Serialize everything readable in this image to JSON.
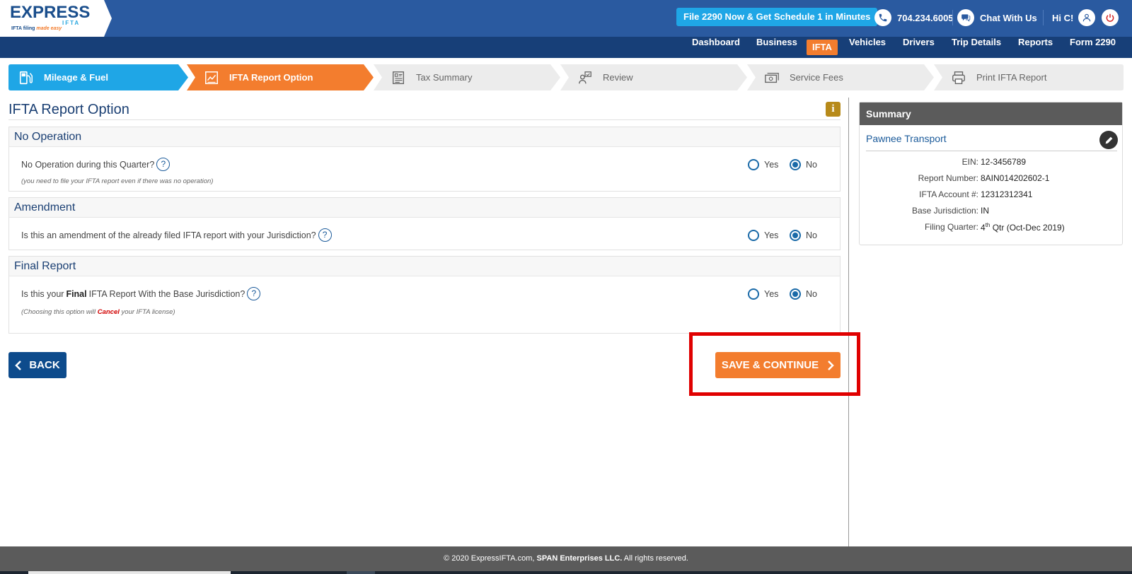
{
  "header": {
    "logo_text_e": "E",
    "logo_text_rest": "XPRESS",
    "logo_sub": "IFTA",
    "logo_tagline": "IFTA filing",
    "logo_tagline_accent": "made easy",
    "promo": "File 2290 Now & Get Schedule 1 in Minutes",
    "phone": "704.234.6005",
    "chat": "Chat With Us",
    "greeting": "Hi C!"
  },
  "nav": [
    "Dashboard",
    "Business",
    "IFTA",
    "Vehicles",
    "Drivers",
    "Trip Details",
    "Reports",
    "Form 2290"
  ],
  "nav_active": "IFTA",
  "steps": [
    {
      "label": "Mileage & Fuel",
      "state": "done",
      "icon": "fuel-pump-icon"
    },
    {
      "label": "IFTA Report Option",
      "state": "current",
      "icon": "report-chart-icon"
    },
    {
      "label": "Tax Summary",
      "state": "pending",
      "icon": "tax-summary-icon"
    },
    {
      "label": "Review",
      "state": "pending",
      "icon": "review-person-icon"
    },
    {
      "label": "Service Fees",
      "state": "pending",
      "icon": "cash-icon"
    },
    {
      "label": "Print IFTA Report",
      "state": "pending",
      "icon": "printer-icon"
    }
  ],
  "page": {
    "title": "IFTA Report Option",
    "info_symbol": "i"
  },
  "sections": {
    "no_operation": {
      "title": "No Operation",
      "question": "No Operation during this Quarter?",
      "note": "(you need to file your IFTA report even if there was no operation)",
      "selected": "No"
    },
    "amendment": {
      "title": "Amendment",
      "question": "Is this an amendment of the already filed IFTA report with your Jurisdiction?",
      "selected": "No"
    },
    "final_report": {
      "title": "Final Report",
      "question_prefix": "Is this your",
      "question_bold": "Final",
      "question_suffix": "IFTA Report With the Base Jurisdiction?",
      "note_prefix": "(Choosing this option will",
      "note_bold": "Cancel",
      "note_suffix": "your IFTA license)",
      "selected": "No"
    }
  },
  "radio_labels": {
    "yes": "Yes",
    "no": "No"
  },
  "help_symbol": "?",
  "buttons": {
    "back": "BACK",
    "save": "SAVE & CONTINUE"
  },
  "summary": {
    "title": "Summary",
    "business_name": "Pawnee Transport",
    "rows": [
      {
        "key": "EIN:",
        "value": "12-3456789"
      },
      {
        "key": "Report Number:",
        "value": "8AIN014202602-1"
      },
      {
        "key": "IFTA Account #:",
        "value": "12312312341"
      },
      {
        "key": "Base Jurisdiction:",
        "value": "IN"
      }
    ],
    "filing_quarter_key": "Filing Quarter:",
    "filing_quarter_num": "4",
    "filing_quarter_sup": "th",
    "filing_quarter_rest": " Qtr (Oct-Dec 2019)"
  },
  "footer": {
    "prefix": "© 2020 ExpressIFTA.com,",
    "company": "SPAN Enterprises LLC.",
    "suffix": "All rights reserved."
  },
  "colors": {
    "header_blue": "#2a5aa0",
    "nav_blue": "#173f78",
    "accent_orange": "#f37d2e",
    "step_blue": "#1fa6e6",
    "highlight_red": "#e00000"
  }
}
